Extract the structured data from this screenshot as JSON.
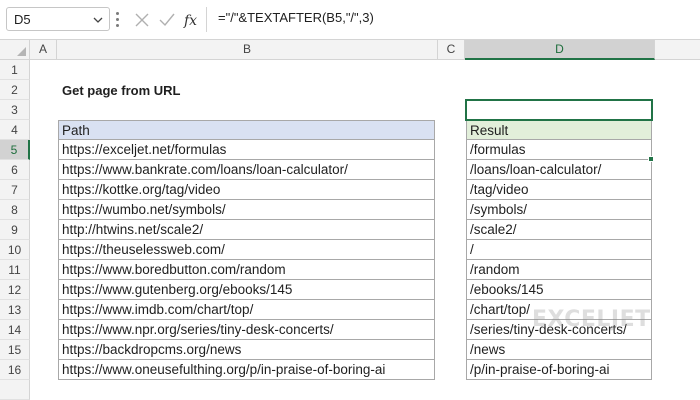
{
  "formula_bar": {
    "name_box": "D5",
    "formula": "=\"/\"&TEXTAFTER(B5,\"/\",3)",
    "fx_label": "fx"
  },
  "columns": [
    "A",
    "B",
    "C",
    "D"
  ],
  "rows": [
    "1",
    "2",
    "3",
    "4",
    "5",
    "6",
    "7",
    "8",
    "9",
    "10",
    "11",
    "12",
    "13",
    "14",
    "15",
    "16"
  ],
  "sheet": {
    "title": "Get page from URL",
    "path_header": "Path",
    "result_header": "Result",
    "paths": [
      "https://exceljet.net/formulas",
      "https://www.bankrate.com/loans/loan-calculator/",
      "https://kottke.org/tag/video",
      "https://wumbo.net/symbols/",
      "http://htwins.net/scale2/",
      "https://theuselessweb.com/",
      "https://www.boredbutton.com/random",
      "https://www.gutenberg.org/ebooks/145",
      "https://www.imdb.com/chart/top/",
      "https://www.npr.org/series/tiny-desk-concerts/",
      "https://backdropcms.org/news",
      "https://www.oneusefulthing.org/p/in-praise-of-boring-ai"
    ],
    "results": [
      "/formulas",
      "/loans/loan-calculator/",
      "/tag/video",
      "/symbols/",
      "/scale2/",
      "/",
      "/random",
      "/ebooks/145",
      "/chart/top/",
      "/series/tiny-desk-concerts/",
      "/news",
      "/p/in-praise-of-boring-ai"
    ]
  },
  "watermark": {
    "text": "EXCELJET"
  },
  "colors": {
    "accent": "#217346",
    "path_header_bg": "#d9e1f2",
    "result_header_bg": "#e2efda"
  }
}
